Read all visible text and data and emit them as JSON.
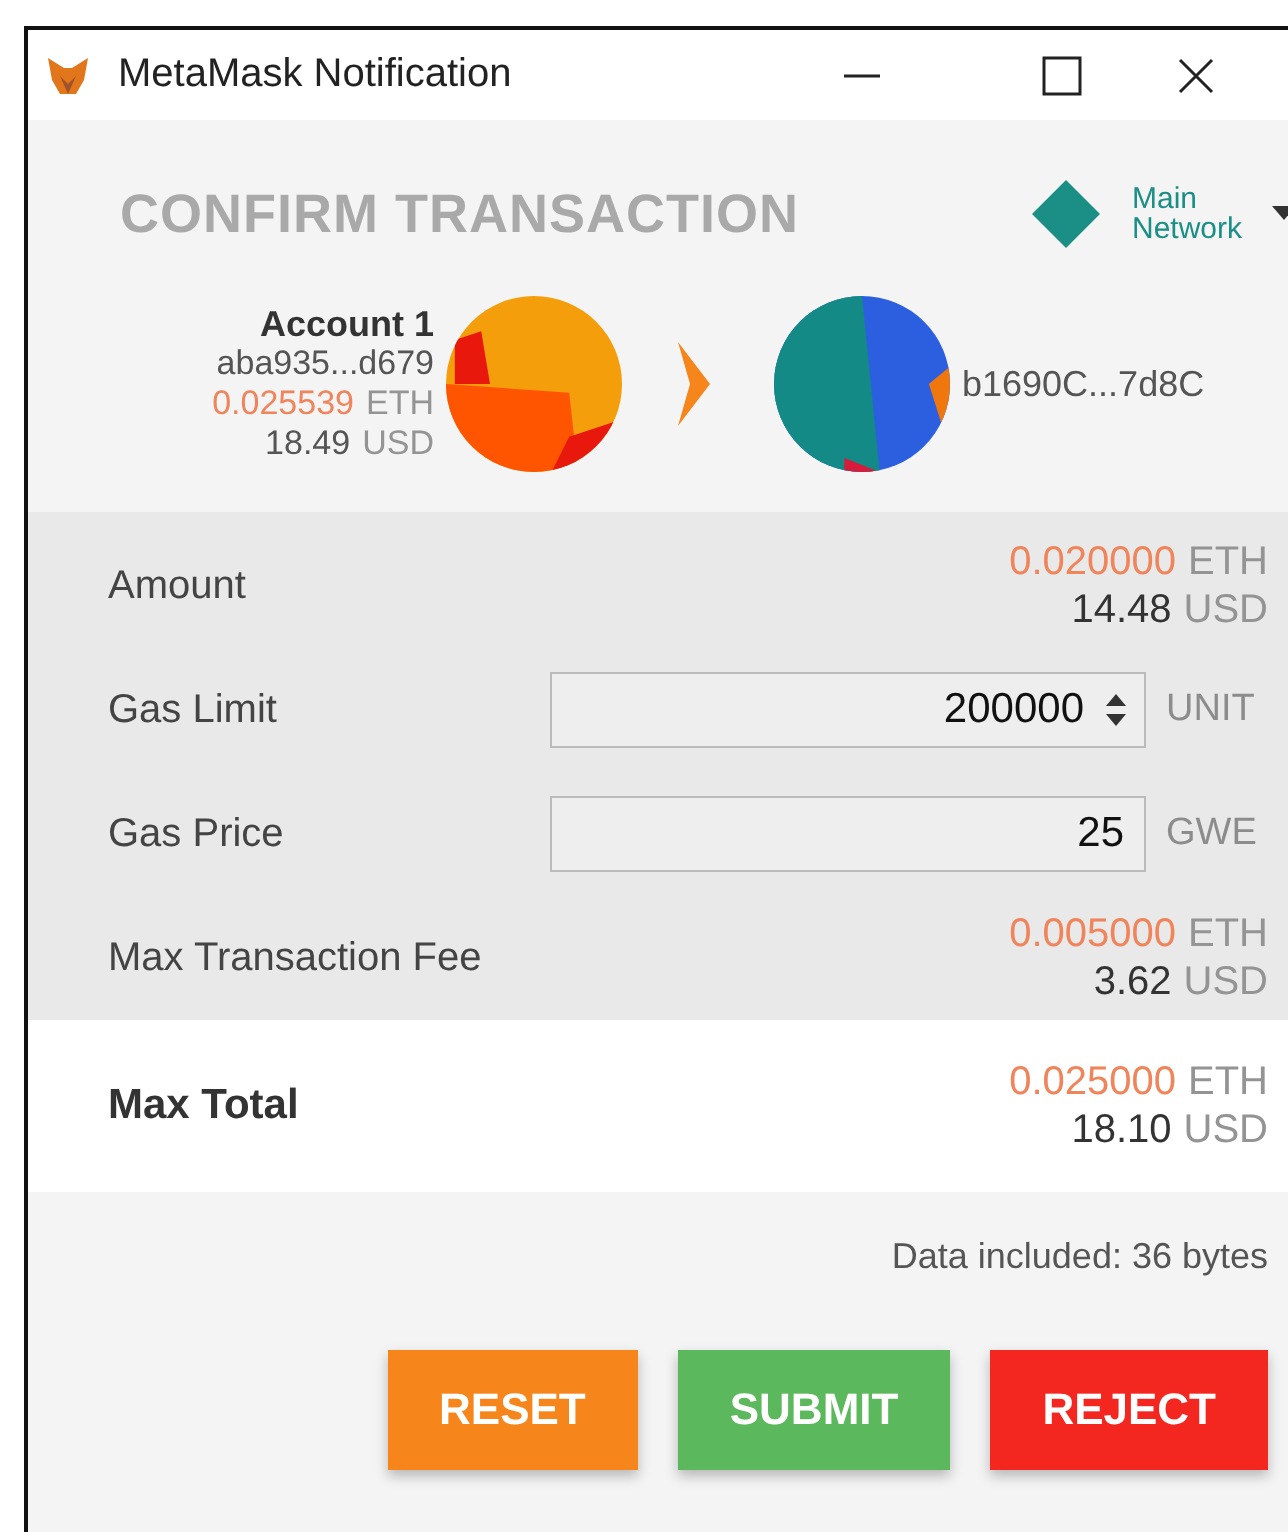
{
  "window": {
    "title": "MetaMask Notification"
  },
  "header": {
    "title": "CONFIRM TRANSACTION",
    "network": "Main Network"
  },
  "sender": {
    "name": "Account 1",
    "address": "aba935...d679",
    "balance": "0.025539",
    "balance_unit": "ETH",
    "fiat": "18.49",
    "fiat_unit": "USD"
  },
  "recipient": {
    "address": "b1690C...7d8C"
  },
  "rows": [
    {
      "kind": "value",
      "label": "Amount",
      "eth": "0.020000",
      "eth_unit": "ETH",
      "usd": "14.48",
      "usd_unit": "USD"
    },
    {
      "kind": "spinner-input",
      "label": "Gas Limit",
      "value": "200000",
      "unit": "UNIT"
    },
    {
      "kind": "input",
      "label": "Gas Price",
      "value": "25",
      "unit": "GWE"
    },
    {
      "kind": "value",
      "label": "Max Transaction Fee",
      "eth": "0.005000",
      "eth_unit": "ETH",
      "usd": "3.62",
      "usd_unit": "USD"
    }
  ],
  "total": {
    "label": "Max Total",
    "eth": "0.025000",
    "eth_unit": "ETH",
    "usd": "18.10",
    "usd_unit": "USD"
  },
  "data_note": "Data included: 36 bytes",
  "buttons": [
    {
      "kind": "reset",
      "label": "RESET"
    },
    {
      "kind": "submit",
      "label": "SUBMIT"
    },
    {
      "kind": "reject",
      "label": "REJECT"
    }
  ]
}
